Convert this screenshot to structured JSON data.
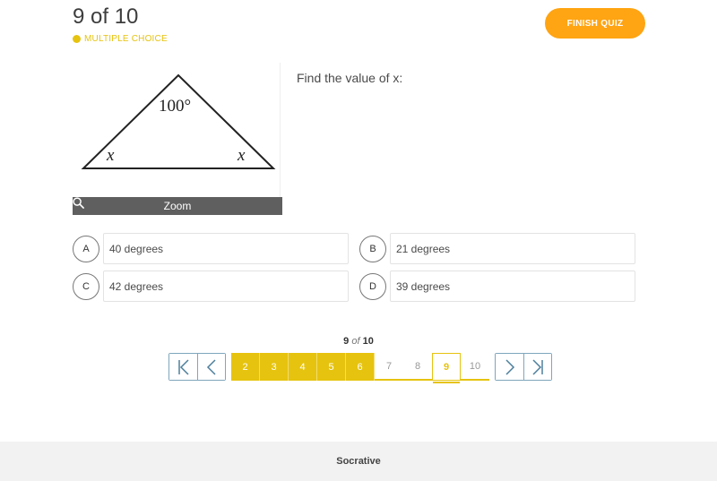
{
  "header": {
    "progress_title": "9 of 10",
    "question_type": "MULTIPLE CHOICE",
    "finish_label": "FINISH QUIZ"
  },
  "question": {
    "image": {
      "apex_angle_label": "100°",
      "left_angle_label": "x",
      "right_angle_label": "x"
    },
    "zoom_label": "Zoom",
    "prompt": "Find the value of x:"
  },
  "answers": [
    {
      "letter": "A",
      "text": "40 degrees"
    },
    {
      "letter": "B",
      "text": "21 degrees"
    },
    {
      "letter": "C",
      "text": "42 degrees"
    },
    {
      "letter": "D",
      "text": "39 degrees"
    }
  ],
  "pager": {
    "current": "9",
    "of_word": "of",
    "total": "10",
    "pages": [
      {
        "label": "2",
        "state": "answered"
      },
      {
        "label": "3",
        "state": "answered"
      },
      {
        "label": "4",
        "state": "answered"
      },
      {
        "label": "5",
        "state": "answered"
      },
      {
        "label": "6",
        "state": "answered"
      },
      {
        "label": "7",
        "state": "unanswered"
      },
      {
        "label": "8",
        "state": "unanswered"
      },
      {
        "label": "9",
        "state": "current"
      },
      {
        "label": "10",
        "state": "unanswered"
      }
    ]
  },
  "footer": {
    "brand": "Socrative"
  },
  "colors": {
    "accent_yellow": "#e6c30f",
    "finish_orange": "#ffa412",
    "nav_blue": "#4d7f9c"
  }
}
